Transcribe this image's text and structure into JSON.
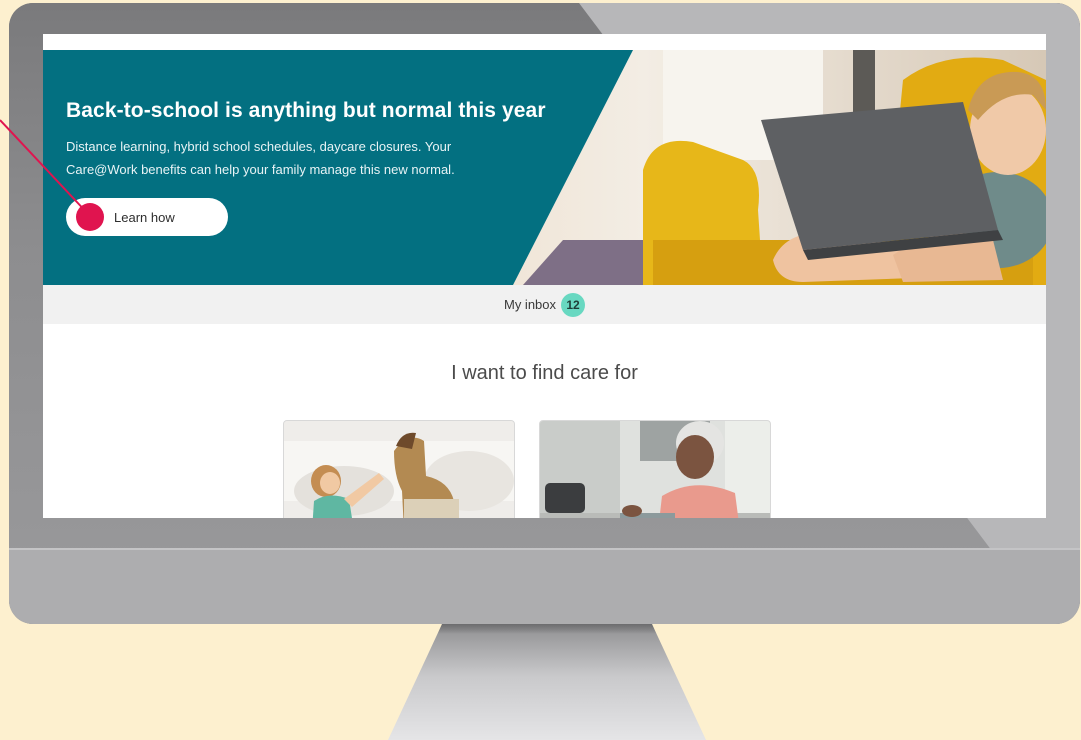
{
  "hero": {
    "title": "Back-to-school is anything but normal this year",
    "subtitle": "Distance learning, hybrid school schedules, daycare closures. Your Care@Work benefits can help your family manage this new normal.",
    "cta_label": "Learn how"
  },
  "inbox": {
    "label": "My inbox",
    "count": "12"
  },
  "care": {
    "heading": "I want to find care for"
  },
  "colors": {
    "hero_panel": "#037081",
    "badge": "#68d8c1",
    "annotation": "#e0144f",
    "background": "#fdf0cf"
  }
}
